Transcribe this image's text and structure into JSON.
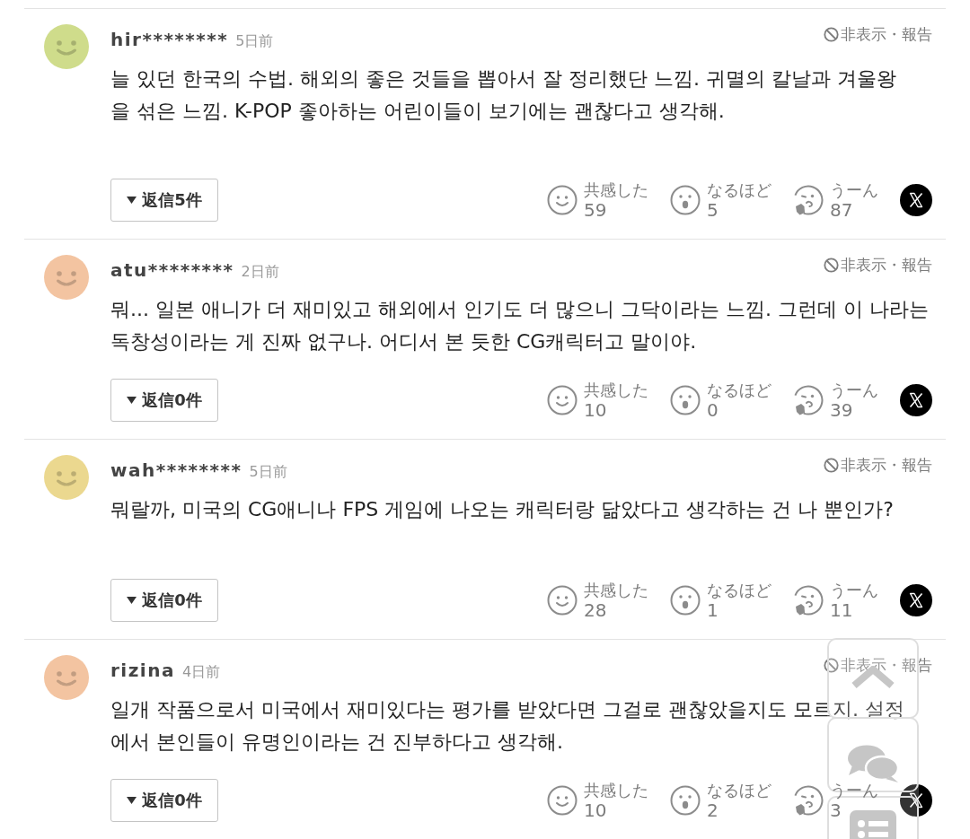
{
  "comments": [
    {
      "user": "hir********",
      "time": "5日前",
      "color": "#cfdc8b",
      "hide": "非表示",
      "divider": "・",
      "report": "報告",
      "lines": [
        "늘 있던 한국의 수법. 해외의 좋은 것들을 뽑아서 잘 정리했단 느낌. 귀멸의 칼날과 겨울왕",
        "을 섞은 느낌. K-POP 좋아하는 어린이들이 보기에는 괜찮다고 생각해."
      ],
      "replies": "返信5件",
      "reactions": [
        {
          "kind": "smile",
          "label": "共感した",
          "count": "59"
        },
        {
          "kind": "surprised",
          "label": "なるほど",
          "count": "5"
        },
        {
          "kind": "thinking",
          "label": "うーん",
          "count": "87"
        }
      ]
    },
    {
      "user": "atu********",
      "time": "2日前",
      "color": "#f3c4a1",
      "hide": "非表示",
      "divider": "・",
      "report": "報告",
      "lines": [
        "뭐... 일본 애니가 더 재미있고 해외에서 인기도 더 많으니 그닥이라는 느낌. 그런데 이 나라는",
        "독창성이라는 게 진짜 없구나. 어디서 본 듯한 CG캐릭터고 말이야."
      ],
      "replies": "返信0件",
      "reactions": [
        {
          "kind": "smile",
          "label": "共感した",
          "count": "10"
        },
        {
          "kind": "surprised",
          "label": "なるほど",
          "count": "0"
        },
        {
          "kind": "thinking",
          "label": "うーん",
          "count": "39"
        }
      ]
    },
    {
      "user": "wah********",
      "time": "5日前",
      "color": "#ebd88f",
      "hide": "非表示",
      "divider": "・",
      "report": "報告",
      "lines": [
        "뭐랄까, 미국의 CG애니나 FPS 게임에 나오는 캐릭터랑 닮았다고 생각하는 건 나 뿐인가?"
      ],
      "replies": "返信0件",
      "reactions": [
        {
          "kind": "smile",
          "label": "共感した",
          "count": "28"
        },
        {
          "kind": "surprised",
          "label": "なるほど",
          "count": "1"
        },
        {
          "kind": "thinking",
          "label": "うーん",
          "count": "11"
        }
      ]
    },
    {
      "user": "rizina",
      "time": "4日前",
      "color": "#f3c4a1",
      "hide": "非表示",
      "divider": "・",
      "report": "報告",
      "lines": [
        "일개 작품으로서 미국에서 재미있다는 평가를 받았다면 그걸로 괜찮았을지도 모르지. 설정",
        "에서 본인들이 유명인이라는 건 진부하다고 생각해."
      ],
      "replies": "返信0件",
      "reactions": [
        {
          "kind": "smile",
          "label": "共感した",
          "count": "10"
        },
        {
          "kind": "surprised",
          "label": "なるほど",
          "count": "2"
        },
        {
          "kind": "thinking",
          "label": "うーん",
          "count": "3"
        }
      ]
    }
  ],
  "floating_buttons": [
    {
      "kind": "scroll-top"
    },
    {
      "kind": "comments"
    },
    {
      "kind": "list"
    }
  ]
}
